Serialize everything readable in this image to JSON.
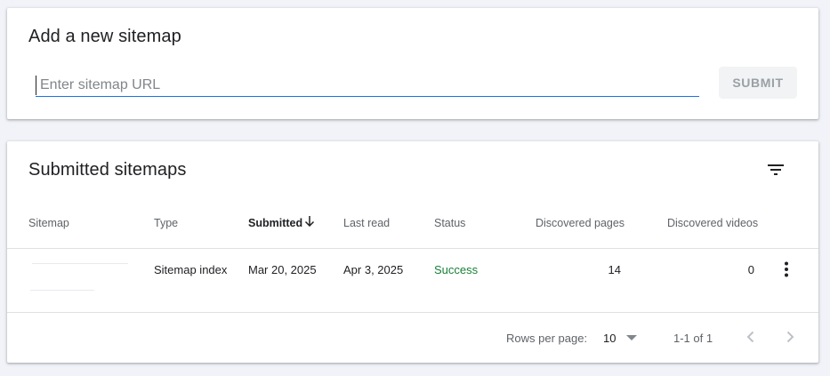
{
  "add_card": {
    "title": "Add a new sitemap",
    "url_placeholder": "Enter sitemap URL",
    "url_value": "",
    "submit_label": "SUBMIT"
  },
  "list_card": {
    "title": "Submitted sitemaps",
    "filter_icon": "filter-icon",
    "columns": {
      "sitemap": "Sitemap",
      "type": "Type",
      "submitted": "Submitted",
      "last_read": "Last read",
      "status": "Status",
      "discovered_pages": "Discovered pages",
      "discovered_videos": "Discovered videos"
    },
    "sort_column": "submitted",
    "sort_direction": "descending",
    "rows": [
      {
        "sitemap": "",
        "type": "Sitemap index",
        "submitted": "Mar 20, 2025",
        "last_read": "Apr 3, 2025",
        "status": "Success",
        "discovered_pages": "14",
        "discovered_videos": "0"
      }
    ],
    "footer": {
      "rows_per_page_label": "Rows per page:",
      "rows_per_page_value": "10",
      "range": "1-1 of 1"
    }
  },
  "colors": {
    "background": "#f1f3f8",
    "accent": "#1a73e8",
    "success": "#188038",
    "disabled_button_bg": "#f1f3f4",
    "disabled_text": "#9aa0a6"
  }
}
